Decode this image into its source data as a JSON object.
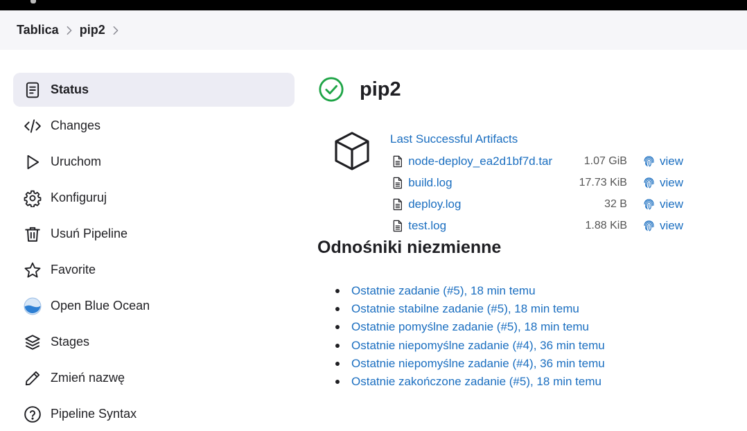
{
  "breadcrumb": {
    "items": [
      "Tablica",
      "pip2"
    ]
  },
  "sidebar": {
    "items": [
      {
        "label": "Status",
        "icon": "document-icon",
        "active": true
      },
      {
        "label": "Changes",
        "icon": "code-icon"
      },
      {
        "label": "Uruchom",
        "icon": "play-icon"
      },
      {
        "label": "Konfiguruj",
        "icon": "gear-icon"
      },
      {
        "label": "Usuń Pipeline",
        "icon": "trash-icon"
      },
      {
        "label": "Favorite",
        "icon": "star-icon"
      },
      {
        "label": "Open Blue Ocean",
        "icon": "blue-ocean-icon"
      },
      {
        "label": "Stages",
        "icon": "layers-icon"
      },
      {
        "label": "Zmień nazwę",
        "icon": "pencil-icon"
      },
      {
        "label": "Pipeline Syntax",
        "icon": "help-icon"
      }
    ]
  },
  "main": {
    "title": "pip2",
    "status_icon": "success-check-icon",
    "status_color": "#1ea446",
    "artifacts": {
      "heading": "Last Successful Artifacts",
      "view_label": "view",
      "files": [
        {
          "name": "node-deploy_ea2d1bf7d.tar",
          "size": "1.07 GiB"
        },
        {
          "name": "build.log",
          "size": "17.73 KiB"
        },
        {
          "name": "deploy.log",
          "size": "32 B"
        },
        {
          "name": "test.log",
          "size": "1.88 KiB"
        }
      ]
    },
    "permalinks": {
      "heading": "Odnośniki niezmienne",
      "items": [
        "Ostatnie zadanie (#5), 18 min temu",
        "Ostatnie stabilne zadanie (#5), 18 min temu",
        "Ostatnie pomyślne zadanie (#5), 18 min temu",
        "Ostatnie niepomyślne zadanie (#4), 36 min temu",
        "Ostatnie niepomyślne zadanie (#4), 36 min temu",
        "Ostatnie zakończone zadanie (#5), 18 min temu"
      ]
    }
  },
  "colors": {
    "link": "#1a6ec0",
    "active_bg": "#ececf4",
    "breadcrumb_bg": "#f6f6f9"
  }
}
